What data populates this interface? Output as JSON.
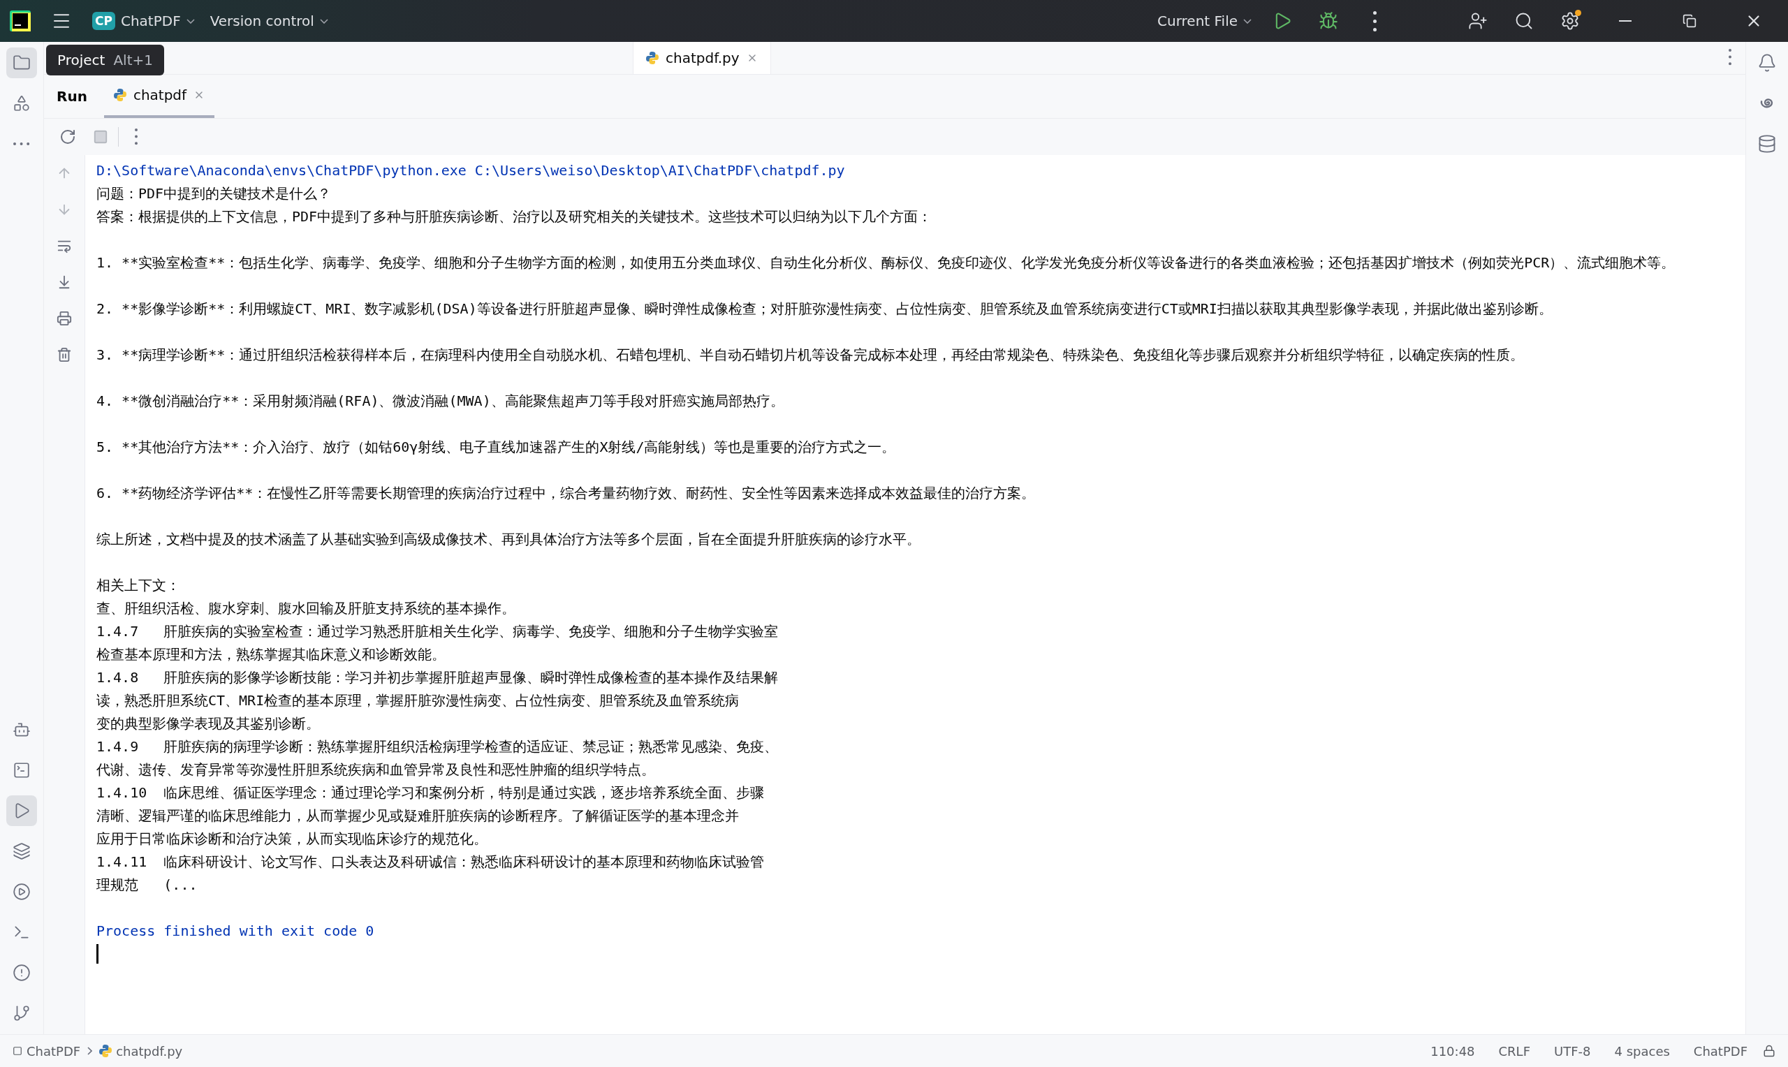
{
  "title_bar": {
    "project_badge": "CP",
    "project": "ChatPDF",
    "vcs": "Version control",
    "run_config": "Current File"
  },
  "tooltip": {
    "label": "Project",
    "shortcut": "Alt+1"
  },
  "left_tools_top": [
    {
      "kind": "folder",
      "selected": true
    },
    {
      "kind": "structure",
      "selected": false
    },
    {
      "kind": "more",
      "selected": false
    }
  ],
  "left_tools_bottom": [
    {
      "kind": "assistant",
      "selected": false
    },
    {
      "kind": "python-console",
      "selected": false
    },
    {
      "kind": "run",
      "selected": true
    },
    {
      "kind": "layers",
      "selected": false
    },
    {
      "kind": "services",
      "selected": false
    },
    {
      "kind": "terminal",
      "selected": false
    },
    {
      "kind": "problems",
      "selected": false
    },
    {
      "kind": "git",
      "selected": false
    }
  ],
  "editor_tabs": [
    {
      "label": "chatpdf.py",
      "selected": true
    }
  ],
  "run_panel": {
    "title": "Run",
    "tabs": [
      {
        "label": "chatpdf",
        "selected": true
      }
    ]
  },
  "console": {
    "lines": [
      {
        "kind": "command",
        "text": "D:\\Software\\Anaconda\\envs\\ChatPDF\\python.exe C:\\Users\\weiso\\Desktop\\AI\\ChatPDF\\chatpdf.py"
      },
      {
        "kind": "text",
        "text": "问题：PDF中提到的关键技术是什么？"
      },
      {
        "kind": "text",
        "text": "答案：根据提供的上下文信息，PDF中提到了多种与肝脏疾病诊断、治疗以及研究相关的关键技术。这些技术可以归纳为以下几个方面："
      },
      {
        "kind": "blank"
      },
      {
        "kind": "text",
        "text": "1. **实验室检查**：包括生化学、病毒学、免疫学、细胞和分子生物学方面的检测，如使用五分类血球仪、自动生化分析仪、酶标仪、免疫印迹仪、化学发光免疫分析仪等设备进行的各类血液检验；还包括基因扩增技术（例如荧光PCR）、流式细胞术等。"
      },
      {
        "kind": "blank"
      },
      {
        "kind": "text",
        "text": "2. **影像学诊断**：利用螺旋CT、MRI、数字减影机(DSA)等设备进行肝脏超声显像、瞬时弹性成像检查；对肝脏弥漫性病变、占位性病变、胆管系统及血管系统病变进行CT或MRI扫描以获取其典型影像学表现，并据此做出鉴别诊断。"
      },
      {
        "kind": "blank"
      },
      {
        "kind": "text",
        "text": "3. **病理学诊断**：通过肝组织活检获得样本后，在病理科内使用全自动脱水机、石蜡包埋机、半自动石蜡切片机等设备完成标本处理，再经由常规染色、特殊染色、免疫组化等步骤后观察并分析组织学特征，以确定疾病的性质。"
      },
      {
        "kind": "blank"
      },
      {
        "kind": "text",
        "text": "4. **微创消融治疗**：采用射频消融(RFA)、微波消融(MWA)、高能聚焦超声刀等手段对肝癌实施局部热疗。"
      },
      {
        "kind": "blank"
      },
      {
        "kind": "text",
        "text": "5. **其他治疗方法**：介入治疗、放疗（如钴60γ射线、电子直线加速器产生的X射线/高能射线）等也是重要的治疗方式之一。"
      },
      {
        "kind": "blank"
      },
      {
        "kind": "text",
        "text": "6. **药物经济学评估**：在慢性乙肝等需要长期管理的疾病治疗过程中，综合考量药物疗效、耐药性、安全性等因素来选择成本效益最佳的治疗方案。"
      },
      {
        "kind": "blank"
      },
      {
        "kind": "text",
        "text": "综上所述，文档中提及的技术涵盖了从基础实验到高级成像技术、再到具体治疗方法等多个层面，旨在全面提升肝脏疾病的诊疗水平。"
      },
      {
        "kind": "blank"
      },
      {
        "kind": "text",
        "text": "相关上下文："
      },
      {
        "kind": "text",
        "text": "查、肝组织活检、腹水穿刺、腹水回输及肝脏支持系统的基本操作。"
      },
      {
        "kind": "text",
        "text": "1.4.7\t肝脏疾病的实验室检查：通过学习熟悉肝脏相关生化学、病毒学、免疫学、细胞和分子生物学实验室"
      },
      {
        "kind": "text",
        "text": "检查基本原理和方法，熟练掌握其临床意义和诊断效能。"
      },
      {
        "kind": "text",
        "text": "1.4.8\t肝脏疾病的影像学诊断技能：学习并初步掌握肝脏超声显像、瞬时弹性成像检查的基本操作及结果解"
      },
      {
        "kind": "text",
        "text": "读，熟悉肝胆系统CT、MRI检查的基本原理，掌握肝脏弥漫性病变、占位性病变、胆管系统及血管系统病"
      },
      {
        "kind": "text",
        "text": "变的典型影像学表现及其鉴别诊断。"
      },
      {
        "kind": "text",
        "text": "1.4.9\t肝脏疾病的病理学诊断：熟练掌握肝组织活检病理学检查的适应证、禁忌证；熟悉常见感染、免疫、"
      },
      {
        "kind": "text",
        "text": "代谢、遗传、发育异常等弥漫性肝胆系统疾病和血管异常及良性和恶性肿瘤的组织学特点。"
      },
      {
        "kind": "text",
        "text": "1.4.10\t临床思维、循证医学理念：通过理论学习和案例分析，特别是通过实践，逐步培养系统全面、步骤"
      },
      {
        "kind": "text",
        "text": "清晰、逻辑严谨的临床思维能力，从而掌握少见或疑难肝脏疾病的诊断程序。了解循证医学的基本理念并"
      },
      {
        "kind": "text",
        "text": "应用于日常临床诊断和治疗决策，从而实现临床诊疗的规范化。"
      },
      {
        "kind": "text",
        "text": "1.4.11\t临床科研设计、论文写作、口头表达及科研诚信：熟悉临床科研设计的基本原理和药物临床试验管"
      },
      {
        "kind": "text",
        "text": "理规范\t(..."
      },
      {
        "kind": "blank"
      },
      {
        "kind": "exit",
        "text": "Process finished with exit code 0"
      },
      {
        "kind": "cursor"
      }
    ]
  },
  "status_bar": {
    "breadcrumbs": [
      "ChatPDF",
      "chatpdf.py"
    ],
    "items": [
      "110:48",
      "CRLF",
      "UTF-8",
      "4 spaces",
      "ChatPDF"
    ]
  }
}
